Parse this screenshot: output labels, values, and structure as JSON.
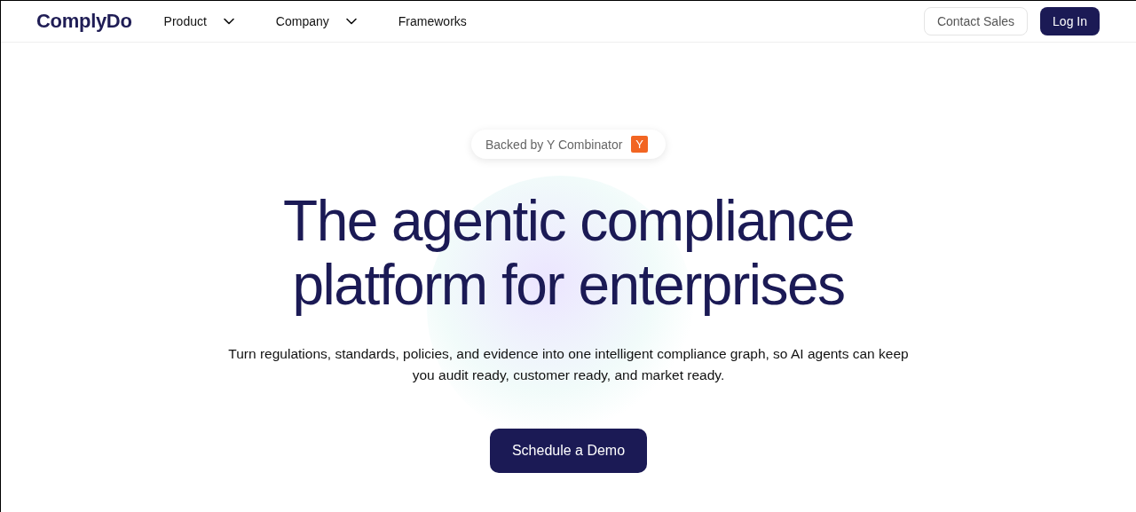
{
  "header": {
    "logo": "ComplyDo",
    "nav": [
      {
        "label": "Product",
        "kind": "dropdown"
      },
      {
        "label": "Company",
        "kind": "dropdown"
      },
      {
        "label": "Frameworks",
        "kind": "link"
      }
    ],
    "contact": "Contact Sales",
    "login": "Log In"
  },
  "hero": {
    "badge": "Backed by Y Combinator",
    "badge_mark": "Y",
    "title_lines": [
      "The agentic compliance",
      "platform for enterprises"
    ],
    "subtitle": "Turn regulations, standards, policies, and evidence into one intelligent compliance graph, so AI agents can keep you audit ready, customer ready, and market ready.",
    "cta": "Schedule a Demo"
  }
}
